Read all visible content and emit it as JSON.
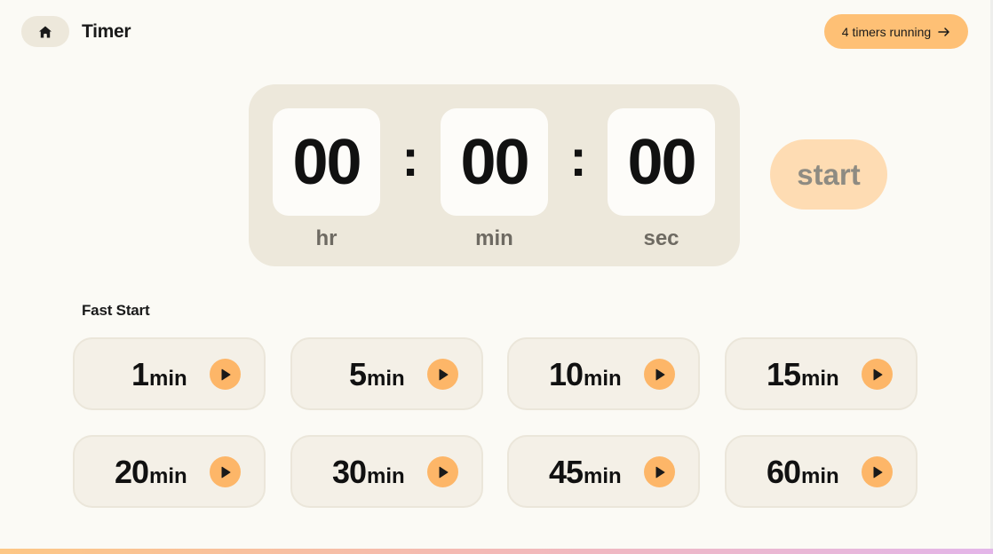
{
  "header": {
    "home_icon": "home-icon",
    "title": "Timer",
    "running_label": "4 timers running",
    "arrow_icon": "arrow-right-icon"
  },
  "timer": {
    "hours": "00",
    "minutes": "00",
    "seconds": "00",
    "separator": ":",
    "hours_label": "hr",
    "minutes_label": "min",
    "seconds_label": "sec",
    "start_label": "start"
  },
  "fast_start": {
    "title": "Fast Start",
    "unit": "min",
    "play_icon": "play-icon",
    "presets": [
      {
        "value": "1"
      },
      {
        "value": "5"
      },
      {
        "value": "10"
      },
      {
        "value": "15"
      },
      {
        "value": "20"
      },
      {
        "value": "30"
      },
      {
        "value": "45"
      },
      {
        "value": "60"
      }
    ]
  },
  "colors": {
    "background": "#fbfaf5",
    "panel": "#ede8db",
    "accent": "#fec075",
    "play": "#fdb668",
    "start_disabled": "#fedcb3"
  }
}
